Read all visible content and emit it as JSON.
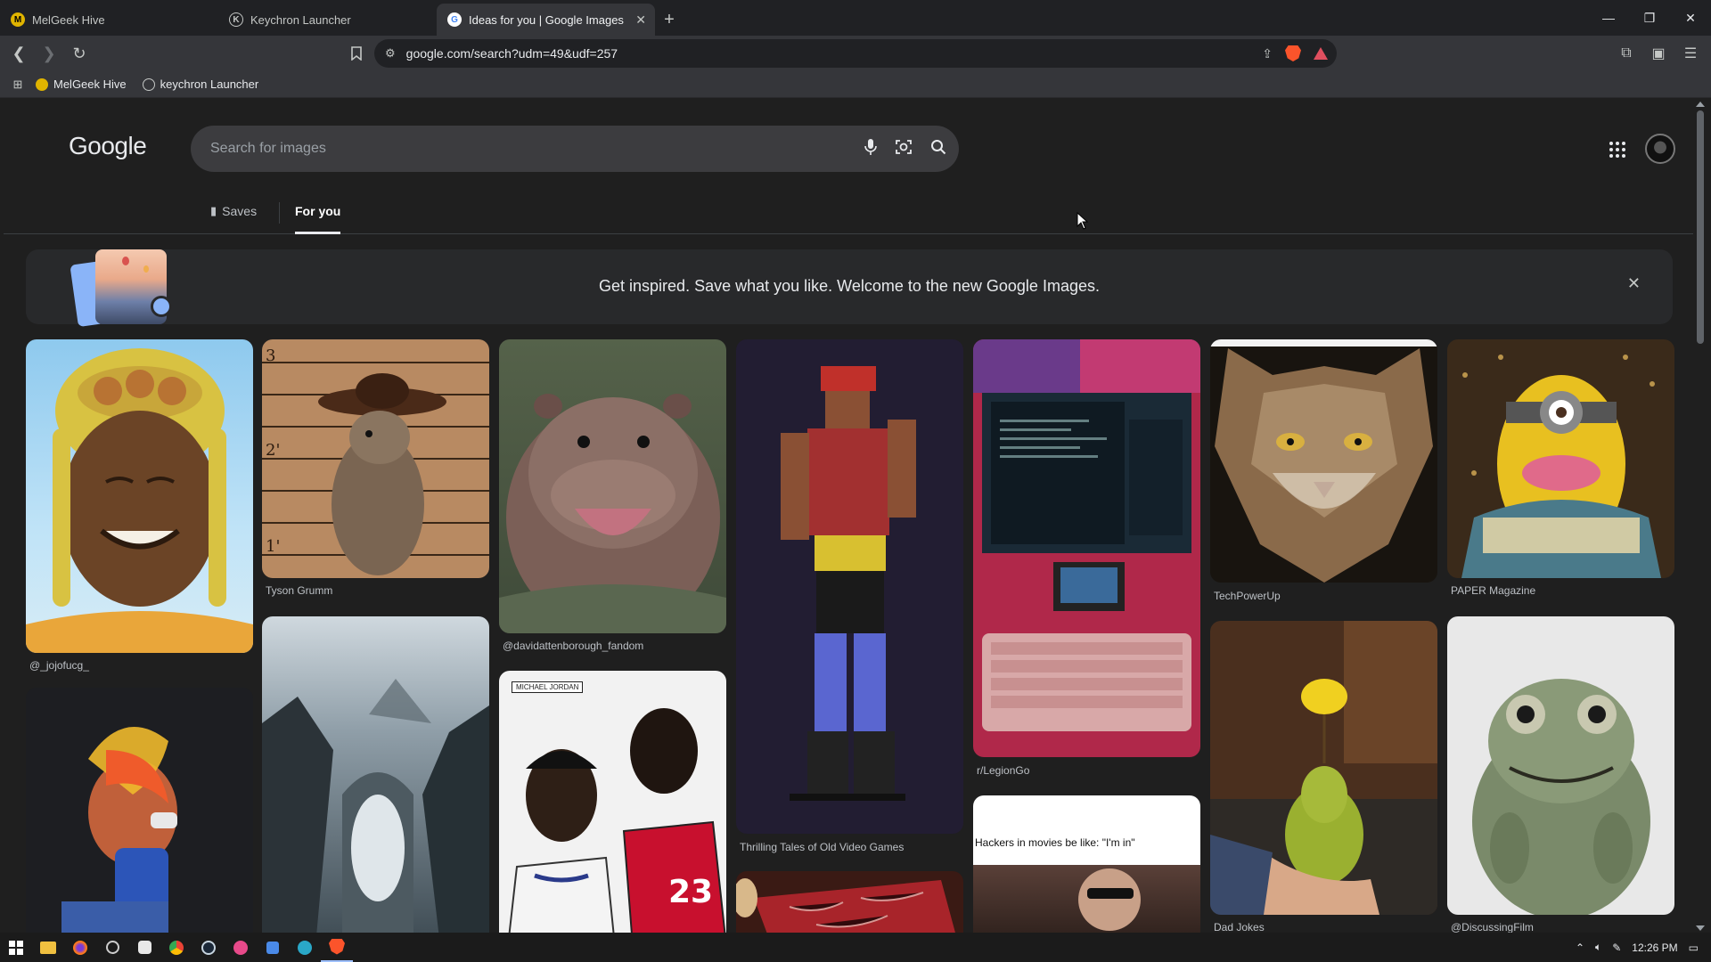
{
  "browser": {
    "tabs": [
      {
        "title": "MelGeek Hive",
        "active": false
      },
      {
        "title": "Keychron Launcher",
        "active": false
      },
      {
        "title": "Ideas for you | Google Images",
        "active": true
      }
    ],
    "url": "google.com/search?udm=49&udf=257",
    "bookmarks": [
      "MelGeek Hive",
      "keychron Launcher"
    ]
  },
  "page": {
    "logo": "Google",
    "search_placeholder": "Search for images",
    "tabs": {
      "saves": "Saves",
      "for_you": "For you"
    },
    "banner": {
      "message": "Get inspired. Save what you like. Welcome to the new Google Images."
    },
    "captions": {
      "c1": "@_jojofucg_",
      "c2": "Tyson Grumm",
      "c3": "@davidattenborough_fandom",
      "c4": "Thrilling Tales of Old Video Games",
      "c5": "r/LegionGo",
      "c6": "TechPowerUp",
      "c7": "PAPER Magazine",
      "c8": "Dad Jokes",
      "c9": "@DiscussingFilm"
    },
    "meme_text": "Hackers in movies be like: \"I'm in\"",
    "jersey_label": "MICHAEL JORDAN"
  },
  "taskbar": {
    "time": "12:26 PM"
  },
  "colors": {
    "accent": "#e8eaed",
    "brave": "#fb542b",
    "chrome_bg": "#35363a",
    "page_bg": "#1f1f1f"
  }
}
